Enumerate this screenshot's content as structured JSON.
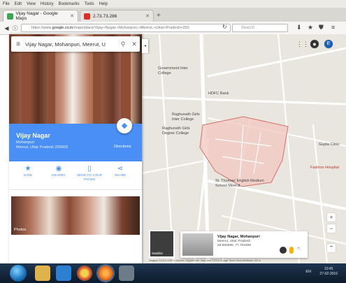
{
  "browser": {
    "menu": [
      "File",
      "Edit",
      "View",
      "History",
      "Bookmarks",
      "Tools",
      "Help"
    ],
    "tabs": [
      {
        "title": "Vijay Nagar - Google Maps",
        "favicon_color": "#3aa757"
      },
      {
        "title": "2.73.73.286",
        "favicon_color": "#d93025"
      }
    ],
    "url_prefix": "https://www.",
    "url_domain": "google.co.in",
    "url_rest": "/maps/place/Vijay+Nagar,+Mohanpuri,+Meerut,+Uttar+Pradesh+250",
    "search_placeholder": "Search"
  },
  "panel": {
    "search_value": "Vijay Nagar, Mohanpuri, Meerut, U",
    "place_name": "Vijay Nagar",
    "place_locality": "Mohanpuri",
    "place_address": "Meerut, Uttar Pradesh 250003",
    "directions_label": "Directions",
    "actions": [
      {
        "icon": "star-icon",
        "glyph": "★",
        "label": "SAVE"
      },
      {
        "icon": "nearby-icon",
        "glyph": "◉",
        "label": "NEARBY"
      },
      {
        "icon": "send-to-phone-icon",
        "glyph": "▯",
        "label": "SEND TO YOUR PHONE"
      },
      {
        "icon": "share-icon",
        "glyph": "⋖",
        "label": "SHARE"
      }
    ],
    "photos_label": "Photos"
  },
  "map": {
    "labels": [
      {
        "key": "govt",
        "text": "Government Inter College"
      },
      {
        "key": "hdfc",
        "text": "HDFC Bank"
      },
      {
        "key": "raghunath1",
        "text": "Raghunath Girls Inter College"
      },
      {
        "key": "raghunath2",
        "text": "Raghunath Girls Degree College"
      },
      {
        "key": "stthomas",
        "text": "St. Thomas' English Medium School Meerut"
      },
      {
        "key": "gupta",
        "text": "Gupta Clinic"
      },
      {
        "key": "fashion",
        "text": "Fashion Hospital"
      }
    ],
    "satellite_label": "Satellite",
    "card_title": "Vijay Nagar, Mohanpuri",
    "card_subtitle": "Meerut, Uttar Pradesh",
    "card_coords": "28.990686, 77.703485",
    "attribution": "Imagery ©2016 CNES / Astrium, DigitalGlobe, Map data ©2016 Google   Terms   Send feedback   100 m"
  },
  "taskbar": {
    "time": "10:45",
    "date": "27-02-2016",
    "lang": "EN"
  }
}
